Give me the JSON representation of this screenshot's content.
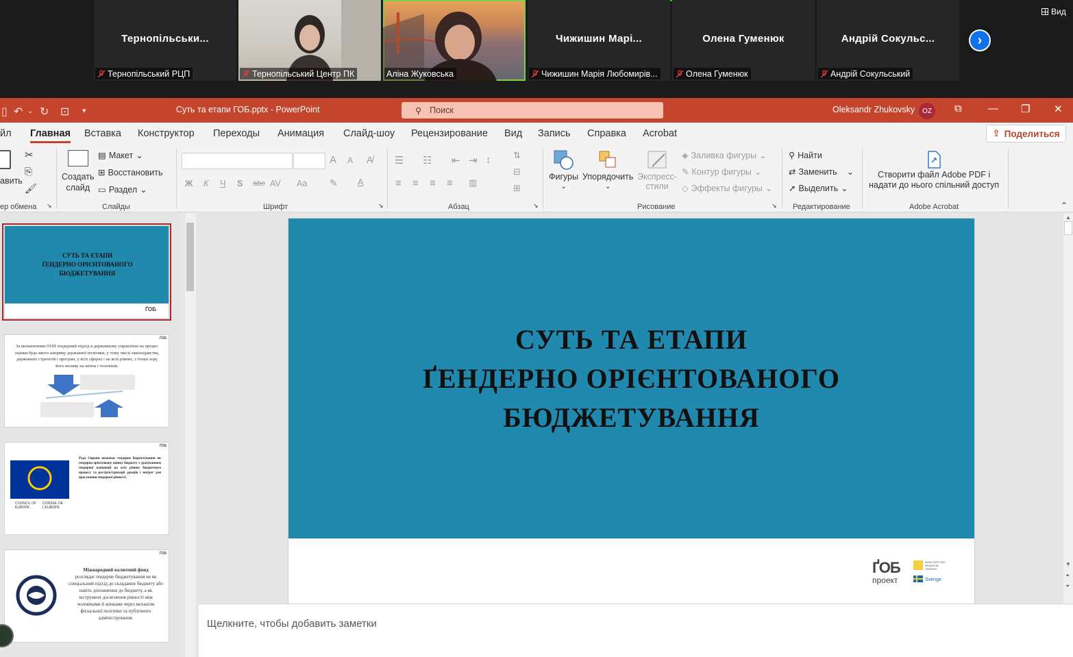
{
  "zoom": {
    "participants": [
      {
        "big_name": "Тернопільськи...",
        "label": "Тернопільський РЦП",
        "video": false
      },
      {
        "big_name": "",
        "label": "Тернопільський Центр ПК",
        "video": true
      },
      {
        "big_name": "",
        "label": "Аліна Жуковська",
        "video": true
      },
      {
        "big_name": "Чижишин  Марі...",
        "label": "Чижишин Марія Любомирів...",
        "video": false
      },
      {
        "big_name": "Олена Гуменюк",
        "label": "Олена Гуменюк",
        "video": false
      },
      {
        "big_name": "Андрій  Сокульс...",
        "label": "Андрій Сокульський",
        "video": false
      }
    ],
    "view_label": "Вид"
  },
  "ppt": {
    "doc_title": "Суть та етапи ГОБ.pptx  -  PowerPoint",
    "search_placeholder": "Поиск",
    "user_name": "Oleksandr Zhukovsky",
    "user_initials": "OZ",
    "menu": [
      "йл",
      "Главная",
      "Вставка",
      "Конструктор",
      "Переходы",
      "Анимация",
      "Слайд-шоу",
      "Рецензирование",
      "Вид",
      "Запись",
      "Справка",
      "Acrobat"
    ],
    "share_label": "Поделиться",
    "ribbon": {
      "clipboard": {
        "paste": "авить",
        "group": "ер обмена"
      },
      "slides": {
        "new_slide_1": "Создать",
        "new_slide_2": "слайд",
        "layout": "Макет",
        "reset": "Восстановить",
        "section": "Раздел",
        "group": "Слайды"
      },
      "font": {
        "group": "Шрифт",
        "bold": "Ж",
        "italic": "К",
        "underline": "Ч",
        "shadow": "S",
        "strike": "abc",
        "spacing": "AV",
        "case": "Aa",
        "color": "A",
        "grow": "A",
        "shrink": "A"
      },
      "paragraph": {
        "group": "Абзац"
      },
      "drawing": {
        "shapes": "Фигуры",
        "arrange": "Упорядочить",
        "quick_styles_1": "Экспресс-",
        "quick_styles_2": "стили",
        "fill": "Заливка фигуры",
        "outline": "Контур фигуры",
        "effects": "Эффекты фигуры",
        "group": "Рисование"
      },
      "editing": {
        "find": "Найти",
        "replace": "Заменить",
        "select": "Выделить",
        "group": "Редактирование"
      },
      "acrobat": {
        "create_1": "Створити файл Adobe PDF і",
        "create_2": "надати до нього спільний доступ",
        "group": "Adobe Acrobat"
      }
    },
    "slide": {
      "title_line1": "СУТЬ ТА ЕТАПИ",
      "title_line2": "ҐЕНДЕРНО ОРІЄНТОВАНОГО",
      "title_line3": "БЮДЖЕТУВАННЯ",
      "logo_main": "ҐОБ",
      "logo_sub": "проект",
      "logo_partner1": "МІНІСТЕРСТВО ФІНАНСІВ УКРАЇНИ",
      "logo_partner2": "Sverige"
    },
    "thumbnails": {
      "t1_line1": "СУТЬ ТА ЕТАПИ",
      "t1_line2": "ҐЕНДЕРНО ОРІЄНТОВАНОГО",
      "t1_line3": "БЮДЖЕТУВАННЯ",
      "t2_text": "За визначенням ООН ґендерний підхід в державному управлінні на процес оцінки будь-якого напряму державної політики, у тому числі законодавства, державних стратегій і програм, у всіх сферах і на всіх рівнях, з точки зору його впливу на жінок і чоловіків.",
      "t3_text": "Рада Європи визначає ґендерне бюджетування як ґендерно орієнтовану оцінку бюджету з урахуванням ґендерної концепції на всіх рівнях бюджетного процесу та реструктуризації доходів і витрат для просування ґендерної рівності.",
      "t3_coe1": "COUNCIL OF EUROPE",
      "t3_coe2": "CONSEIL DE L'EUROPE",
      "t4_heading": "Міжнародний валютний фонд",
      "t4_text": "розглядає ґендерне бюджетування не як спеціальний підхід до складання бюджету або навіть доповнення до бюджету, а як інструмент досягнення рівності між чоловіками й жінками через механізм фіскальної політики та публічного адміністрування."
    },
    "notes_placeholder": "Щелкните, чтобы добавить заметки"
  }
}
